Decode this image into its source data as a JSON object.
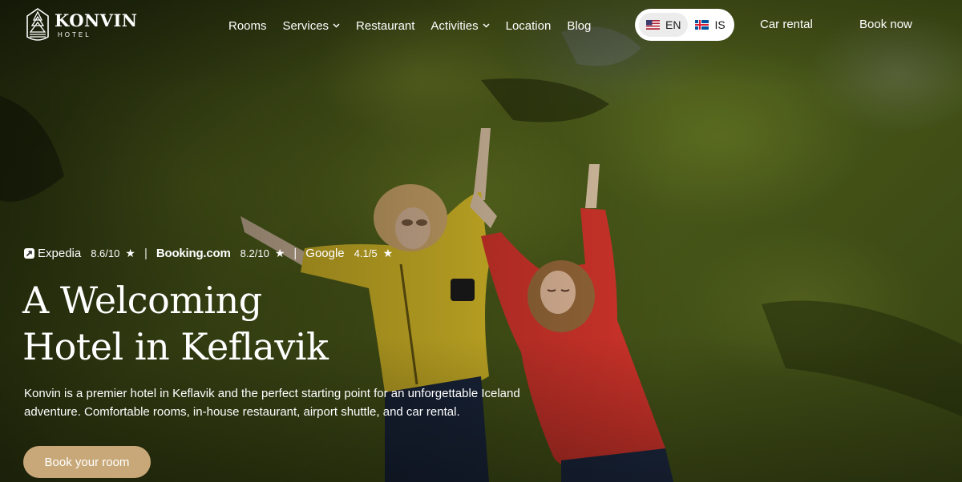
{
  "brand": {
    "name": "KONVIN",
    "sub": "HOTEL"
  },
  "nav": {
    "items": [
      {
        "label": "Rooms",
        "has_dropdown": false
      },
      {
        "label": "Services",
        "has_dropdown": true
      },
      {
        "label": "Restaurant",
        "has_dropdown": false
      },
      {
        "label": "Activities",
        "has_dropdown": true
      },
      {
        "label": "Location",
        "has_dropdown": false
      },
      {
        "label": "Blog",
        "has_dropdown": false
      }
    ],
    "car_rental": "Car rental",
    "book_now": "Book now"
  },
  "language": {
    "options": [
      {
        "code": "EN",
        "flag": "us-flag-icon",
        "active": true
      },
      {
        "code": "IS",
        "flag": "iceland-flag-icon",
        "active": false
      }
    ]
  },
  "ratings": {
    "expedia": {
      "brand": "Expedia",
      "score": "8.6/10"
    },
    "booking": {
      "brand": "Booking.com",
      "score": "8.2/10"
    },
    "google": {
      "brand": "Google",
      "score": "4.1/5"
    },
    "star": "★",
    "separator": "|"
  },
  "hero": {
    "title_line1": "A Welcoming",
    "title_line2": "Hotel in Keflavik",
    "description": "Konvin is a premier hotel in Keflavik and the perfect starting point for an unforgettable Iceland adventure. Comfortable rooms, in-house restaurant, airport shuttle, and car rental.",
    "cta": "Book your room"
  },
  "colors": {
    "accent": "#c8a878",
    "moss": "#56671d",
    "yellow_jacket": "#e3c52a",
    "red_jacket": "#d8362c"
  }
}
